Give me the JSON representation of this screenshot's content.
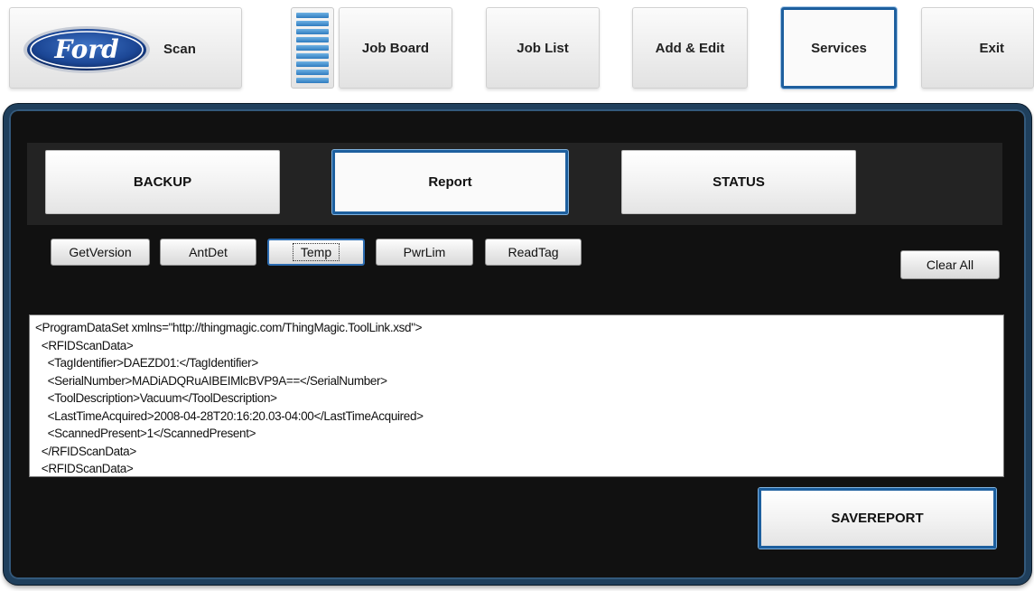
{
  "nav": {
    "scan_label": "Scan",
    "logo_text": "Ford",
    "list_toggle_icon": "list-bars-icon",
    "job_board_label": "Job Board",
    "job_list_label": "Job List",
    "add_edit_label": "Add & Edit",
    "services_label": "Services",
    "exit_label": "Exit",
    "active_tab": "Services"
  },
  "services": {
    "tabs": {
      "backup_label": "BACKUP",
      "report_label": "Report",
      "status_label": "STATUS",
      "active_tab": "Report"
    },
    "commands": {
      "get_version_label": "GetVersion",
      "ant_det_label": "AntDet",
      "temp_label": "Temp",
      "pwr_lim_label": "PwrLim",
      "read_tag_label": "ReadTag",
      "focused": "Temp"
    },
    "clear_all_label": "Clear All",
    "output_lines": [
      "<ProgramDataSet xmlns=\"http://thingmagic.com/ThingMagic.ToolLink.xsd\">",
      "  <RFIDScanData>",
      "    <TagIdentifier>DAEZD01:</TagIdentifier>",
      "    <SerialNumber>MADiADQRuAIBEIMlcBVP9A==</SerialNumber>",
      "    <ToolDescription>Vacuum</ToolDescription>",
      "    <LastTimeAcquired>2008-04-28T20:16:20.03-04:00</LastTimeAcquired>",
      "    <ScannedPresent>1</ScannedPresent>",
      "  </RFIDScanData>",
      "  <RFIDScanData>"
    ],
    "save_report_label": "SAVEREPORT"
  },
  "colors": {
    "accent_border": "#1d5f9e",
    "panel_background": "#111111",
    "panel_frame": "#1f3f5c"
  }
}
